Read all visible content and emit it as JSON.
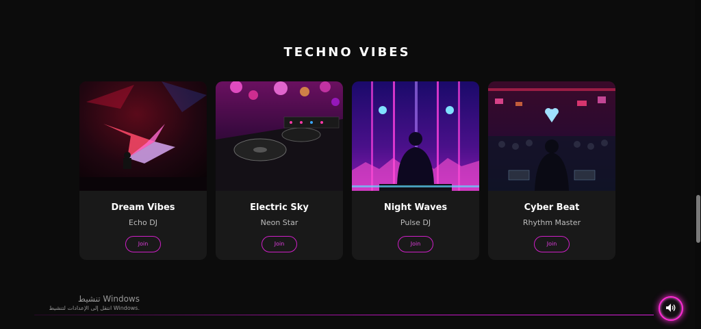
{
  "section": {
    "title": "TECHNO VIBES"
  },
  "cards": [
    {
      "title": "Dream Vibes",
      "artist": "Echo DJ",
      "button": "Join"
    },
    {
      "title": "Electric Sky",
      "artist": "Neon Star",
      "button": "Join"
    },
    {
      "title": "Night Waves",
      "artist": "Pulse DJ",
      "button": "Join"
    },
    {
      "title": "Cyber Beat",
      "artist": "Rhythm Master",
      "button": "Join"
    }
  ],
  "watermark": {
    "title": "تنشيط Windows",
    "subtitle": "انتقل إلى الإعدادات لتنشيط Windows."
  },
  "icons": {
    "sound": "speaker-icon"
  },
  "colors": {
    "accent": "#d11fc9",
    "background": "#0c0c0c",
    "card": "#191919"
  }
}
